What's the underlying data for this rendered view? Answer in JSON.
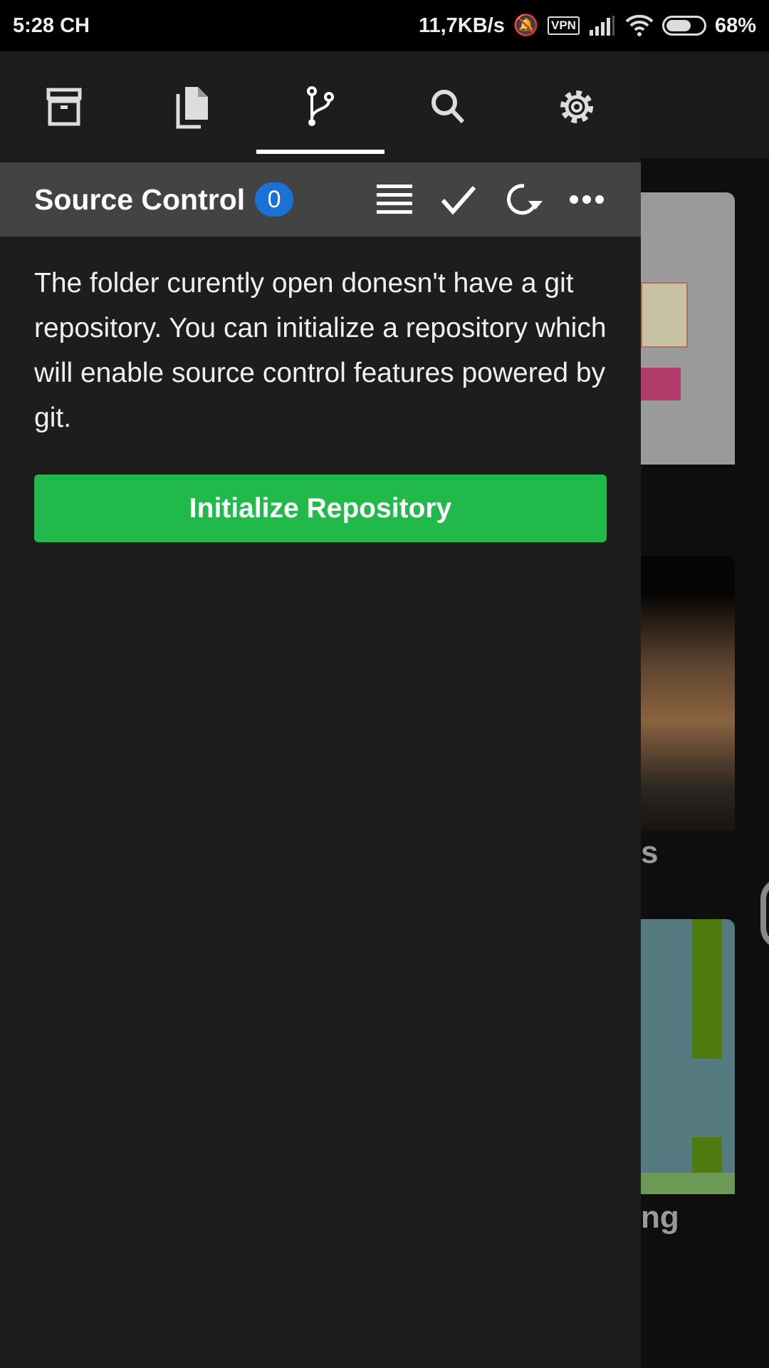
{
  "status": {
    "time": "5:28 CH",
    "speed": "11,7KB/s",
    "vpn": "VPN",
    "battery": "68%",
    "battery_level": 0.68
  },
  "tabs": [
    {
      "icon": "archive-icon"
    },
    {
      "icon": "files-icon"
    },
    {
      "icon": "git-branch-icon",
      "active": true
    },
    {
      "icon": "search-icon"
    },
    {
      "icon": "settings-icon"
    }
  ],
  "source_control": {
    "title": "Source Control",
    "count": "0",
    "actions": [
      "list-icon",
      "check-icon",
      "refresh-icon",
      "more-icon"
    ]
  },
  "message": "The folder curently open donesn't have a git repository. You can initialize a repository which will enable source control features powered by git.",
  "init_button": "Initialize Repository",
  "background": {
    "label1": "s",
    "label2": "ng"
  },
  "colors": {
    "accent": "#21b94a",
    "badge": "#1a72d6",
    "header": "#434343",
    "drawer": "#1d1d1d"
  }
}
